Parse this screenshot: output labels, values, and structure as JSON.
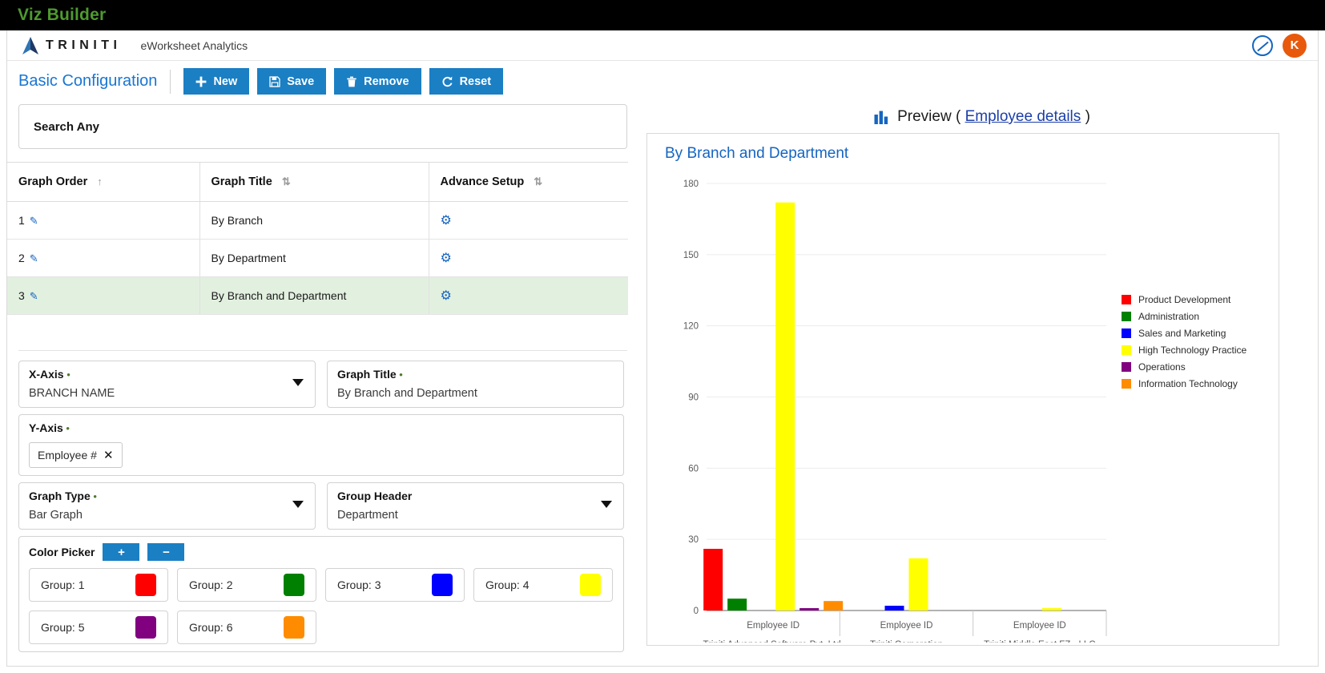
{
  "window": {
    "title": "Viz Builder"
  },
  "brand": {
    "name": "TRINITI",
    "product": "eWorksheet Analytics",
    "avatar_initial": "K"
  },
  "toolbar": {
    "section_title": "Basic Configuration",
    "new_label": "New",
    "save_label": "Save",
    "remove_label": "Remove",
    "reset_label": "Reset"
  },
  "search": {
    "placeholder": "Search Any",
    "value": ""
  },
  "grid": {
    "columns": [
      "Graph Order",
      "Graph Title",
      "Advance Setup"
    ],
    "rows": [
      {
        "order": "1",
        "title": "By Branch",
        "selected": false
      },
      {
        "order": "2",
        "title": "By Department",
        "selected": false
      },
      {
        "order": "3",
        "title": "By Branch and Department",
        "selected": true
      }
    ]
  },
  "form": {
    "x_axis": {
      "label": "X-Axis",
      "value": "BRANCH NAME",
      "required": true
    },
    "graph_title": {
      "label": "Graph Title",
      "value": "By Branch and Department",
      "required": true
    },
    "y_axis": {
      "label": "Y-Axis",
      "required": true,
      "chips": [
        "Employee #"
      ]
    },
    "graph_type": {
      "label": "Graph Type",
      "value": "Bar Graph",
      "required": true
    },
    "group_header": {
      "label": "Group Header",
      "value": "Department",
      "required": false
    },
    "color_picker": {
      "label": "Color Picker",
      "add_label": "+",
      "remove_label": "−",
      "groups": [
        {
          "label": "Group: 1",
          "color": "#ff0000"
        },
        {
          "label": "Group: 2",
          "color": "#008000"
        },
        {
          "label": "Group: 3",
          "color": "#0000ff"
        },
        {
          "label": "Group: 4",
          "color": "#ffff00"
        },
        {
          "label": "Group: 5",
          "color": "#800080"
        },
        {
          "label": "Group: 6",
          "color": "#ff8c00"
        }
      ]
    }
  },
  "preview": {
    "prefix": "Preview (",
    "link": "Employee details",
    "suffix": ")"
  },
  "chart_data": {
    "type": "bar",
    "title": "By Branch and Department",
    "xlabel": "",
    "ylabel": "",
    "ylim": [
      0,
      180
    ],
    "yticks": [
      0,
      30,
      60,
      90,
      120,
      150,
      180
    ],
    "grid": true,
    "legend_position": "right",
    "categories": [
      "Triniti Advanced Software Pvt. Ltd.",
      "Triniti Corporation",
      "Triniti Middle East FZ - LLC"
    ],
    "category_tick_label": "Employee ID",
    "series": [
      {
        "name": "Product Development",
        "color": "#ff0000",
        "values": [
          26,
          0,
          0
        ]
      },
      {
        "name": "Administration",
        "color": "#008000",
        "values": [
          5,
          0,
          0
        ]
      },
      {
        "name": "Sales and Marketing",
        "color": "#0000ff",
        "values": [
          0,
          2,
          0
        ]
      },
      {
        "name": "High Technology Practice",
        "color": "#ffff00",
        "values": [
          172,
          22,
          1
        ]
      },
      {
        "name": "Operations",
        "color": "#800080",
        "values": [
          1,
          0,
          0
        ]
      },
      {
        "name": "Information Technology",
        "color": "#ff8c00",
        "values": [
          4,
          0,
          0
        ]
      }
    ]
  }
}
